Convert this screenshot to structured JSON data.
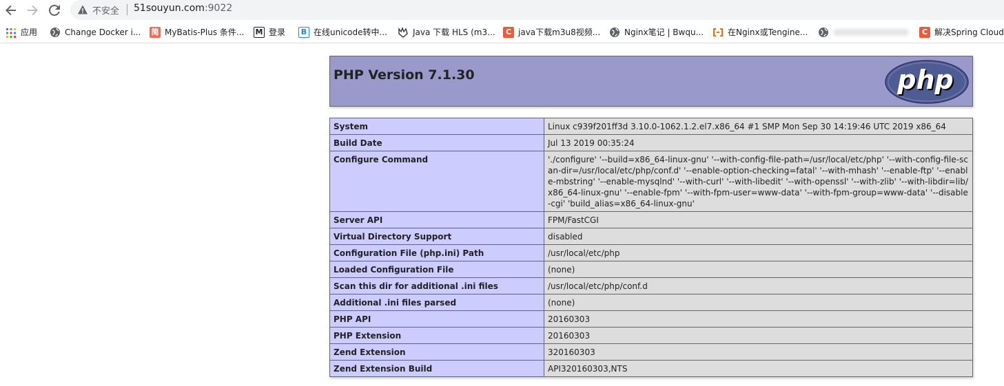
{
  "browser": {
    "nav": {
      "back_icon": "arrow-left-icon",
      "forward_icon": "arrow-right-icon",
      "reload_icon": "reload-icon"
    },
    "omnibox": {
      "security_label": "不安全",
      "host": "51souyun.com",
      "port": ":9022"
    },
    "bookmarks": [
      {
        "icon": "apps-grid-icon",
        "label": "应用"
      },
      {
        "icon": "globe-icon",
        "label": "Change Docker i..."
      },
      {
        "icon": "jianshu-icon",
        "label": "MyBatis-Plus 条件..."
      },
      {
        "icon": "m-logo-icon",
        "label": "登录"
      },
      {
        "icon": "b-logo-icon",
        "label": "在线unicode转中..."
      },
      {
        "icon": "wolf-icon",
        "label": "Java 下载 HLS (m3..."
      },
      {
        "icon": "csdn-icon",
        "label": "java下载m3u8视频..."
      },
      {
        "icon": "globe-icon",
        "label": "Nginx笔记 | Bwqu..."
      },
      {
        "icon": "aliyun-icon",
        "label": "在Nginx或Tengine..."
      },
      {
        "icon": "globe-icon",
        "label": ""
      },
      {
        "icon": "csdn-icon",
        "label": "解决Spring Cloud"
      }
    ],
    "colors": {
      "csdn": "#e95d3c",
      "jianshu": "#ea6f5a",
      "aliyun": "#ff6a00",
      "blue_b": "#1e88e5"
    }
  },
  "php": {
    "title": "PHP Version 7.1.30",
    "logo_text": "php",
    "rows": [
      {
        "key": "System",
        "value": "Linux c939f201ff3d 3.10.0-1062.1.2.el7.x86_64 #1 SMP Mon Sep 30 14:19:46 UTC 2019 x86_64"
      },
      {
        "key": "Build Date",
        "value": "Jul 13 2019 00:35:24"
      },
      {
        "key": "Configure Command",
        "value": "'./configure' '--build=x86_64-linux-gnu' '--with-config-file-path=/usr/local/etc/php' '--with-config-file-scan-dir=/usr/local/etc/php/conf.d' '--enable-option-checking=fatal' '--with-mhash' '--enable-ftp' '--enable-mbstring' '--enable-mysqlnd' '--with-curl' '--with-libedit' '--with-openssl' '--with-zlib' '--with-libdir=lib/x86_64-linux-gnu' '--enable-fpm' '--with-fpm-user=www-data' '--with-fpm-group=www-data' '--disable-cgi' 'build_alias=x86_64-linux-gnu'"
      },
      {
        "key": "Server API",
        "value": "FPM/FastCGI"
      },
      {
        "key": "Virtual Directory Support",
        "value": "disabled"
      },
      {
        "key": "Configuration File (php.ini) Path",
        "value": "/usr/local/etc/php"
      },
      {
        "key": "Loaded Configuration File",
        "value": "(none)"
      },
      {
        "key": "Scan this dir for additional .ini files",
        "value": "/usr/local/etc/php/conf.d"
      },
      {
        "key": "Additional .ini files parsed",
        "value": "(none)"
      },
      {
        "key": "PHP API",
        "value": "20160303"
      },
      {
        "key": "PHP Extension",
        "value": "20160303"
      },
      {
        "key": "Zend Extension",
        "value": "320160303"
      },
      {
        "key": "Zend Extension Build",
        "value": "API320160303,NTS"
      }
    ]
  }
}
